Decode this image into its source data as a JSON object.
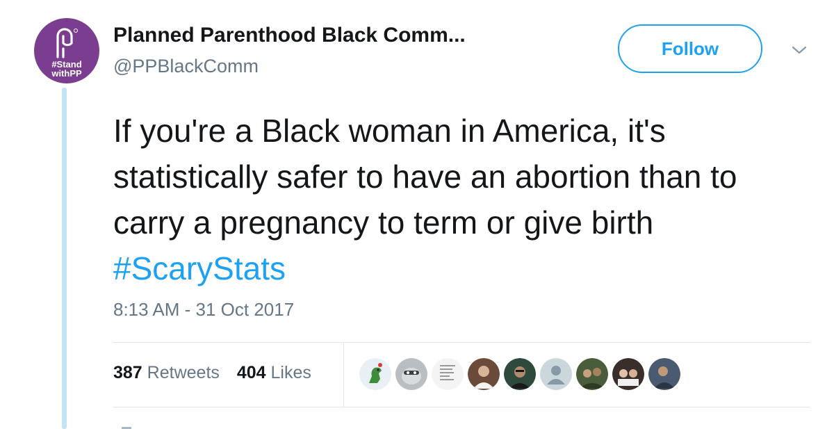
{
  "account": {
    "name": "Planned Parenthood Black Comm...",
    "handle": "@PPBlackComm",
    "avatar_tag_line1": "#Stand",
    "avatar_tag_line2": "withPP"
  },
  "follow_label": "Follow",
  "tweet": {
    "text": "If you're a Black woman in America, it's statistically safer to have an abortion than to carry a pregnancy to term or give birth ",
    "hashtag": "#ScaryStats",
    "timestamp": "8:13 AM - 31 Oct 2017"
  },
  "stats": {
    "retweets_count": "387",
    "retweets_label": "Retweets",
    "likes_count": "404",
    "likes_label": "Likes"
  },
  "liker_avatars": [
    {
      "icon": "green-dinosaur-icon",
      "color": "#e8f0f5"
    },
    {
      "icon": "cartoon-raccoon-icon",
      "color": "#b9bec2"
    },
    {
      "icon": "meme-text-icon",
      "color": "#f4f4f4"
    },
    {
      "icon": "person-photo-icon",
      "color": "#6b4a3a"
    },
    {
      "icon": "person-photo-icon",
      "color": "#2e4a3d"
    },
    {
      "icon": "default-user-icon",
      "color": "#ccd6dd"
    },
    {
      "icon": "outdoor-photo-icon",
      "color": "#4a5d3a"
    },
    {
      "icon": "group-photo-icon",
      "color": "#3a2e2a"
    },
    {
      "icon": "person-photo-icon",
      "color": "#4a5a70"
    }
  ],
  "colors": {
    "brand_purple": "#7b3d8f",
    "twitter_blue": "#1da1f2",
    "thread_line": "#c4e3f5",
    "muted_text": "#657786"
  }
}
